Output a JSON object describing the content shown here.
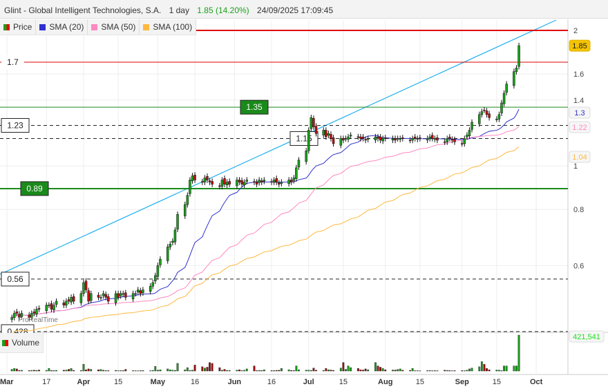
{
  "header": {
    "title": "Glint - Global Intelligent Technologies, S.A.",
    "interval": "1 day",
    "last": "1.85 (14.20%)",
    "datetime": "24/09/2025 17:09:45"
  },
  "legend": {
    "price": "Price",
    "sma20": "SMA (20)",
    "sma50": "SMA (50)",
    "sma100": "SMA (100)",
    "volume": "Volume"
  },
  "watermark": "ProRealTime",
  "colors": {
    "up": "#1aa01a",
    "down": "#c01010",
    "sma20": "#3030d0",
    "sma50": "#ff88c0",
    "sma100": "#ffb840",
    "trend": "#20b0f0",
    "red_level": "#e00000",
    "green_level": "#1a8a1a"
  },
  "chart_data": {
    "type": "candlestick",
    "scale": "log",
    "y_ticks": [
      "2",
      "1.6",
      "1.4",
      "1",
      "0.8",
      "0.6"
    ],
    "x_ticks": [
      "Mar",
      "17",
      "Apr",
      "15",
      "May",
      "16",
      "Jun",
      "16",
      "Jul",
      "15",
      "Aug",
      "15",
      "Sep",
      "15",
      "Oct"
    ],
    "closes": [
      0.46,
      0.47,
      0.47,
      0.46,
      0.47,
      0.46,
      0.47,
      0.47,
      0.48,
      0.48,
      0.49,
      0.49,
      0.48,
      0.49,
      0.5,
      0.49,
      0.5,
      0.5,
      0.51,
      0.5,
      0.52,
      0.55,
      0.53,
      0.5,
      0.52,
      0.51,
      0.51,
      0.52,
      0.51,
      0.5,
      0.52,
      0.51,
      0.52,
      0.52,
      0.51,
      0.52,
      0.52,
      0.53,
      0.52,
      0.53,
      0.54,
      0.55,
      0.57,
      0.6,
      0.62,
      0.66,
      0.67,
      0.68,
      0.72,
      0.78,
      0.82,
      0.86,
      0.93,
      0.95,
      0.93,
      0.92,
      0.94,
      0.93,
      0.92,
      0.91,
      0.9,
      0.93,
      0.91,
      0.92,
      0.91,
      0.93,
      0.92,
      0.91,
      0.92,
      0.93,
      0.92,
      0.91,
      0.93,
      0.92,
      0.93,
      0.92,
      0.93,
      0.92,
      0.91,
      0.92,
      0.93,
      0.92,
      0.94,
      0.99,
      1.03,
      1.08,
      1.2,
      1.28,
      1.22,
      1.18,
      1.2,
      1.16,
      1.18,
      1.15,
      1.12,
      1.15,
      1.14,
      1.15,
      1.16,
      1.17,
      1.16,
      1.15,
      1.15,
      1.14,
      1.15,
      1.16,
      1.15,
      1.14,
      1.15,
      1.15,
      1.15,
      1.14,
      1.15,
      1.15,
      1.15,
      1.14,
      1.15,
      1.15,
      1.15,
      1.15,
      1.15,
      1.16,
      1.15,
      1.15,
      1.14,
      1.13,
      1.15,
      1.15,
      1.14,
      1.13,
      1.12,
      1.15,
      1.17,
      1.2,
      1.25,
      1.3,
      1.32,
      1.33,
      1.3,
      1.28,
      1.27,
      1.3,
      1.38,
      1.45,
      1.52,
      1.62,
      1.65,
      1.85
    ],
    "volumes_thousands": [
      20,
      30,
      25,
      8,
      8,
      6,
      8,
      10,
      8,
      12,
      8,
      30,
      6,
      6,
      8,
      10,
      12,
      20,
      30,
      8,
      6,
      80,
      15,
      25,
      20,
      15,
      18,
      10,
      5,
      5,
      8,
      4,
      5,
      6,
      20,
      5,
      4,
      3,
      5,
      6,
      4,
      8,
      55,
      10,
      15,
      25,
      15,
      10,
      8,
      90,
      15,
      40,
      8,
      10,
      70,
      50,
      35,
      45,
      100,
      90,
      40,
      10,
      20,
      8,
      6,
      10,
      15,
      5,
      10,
      25,
      60,
      5,
      8,
      6,
      15,
      5,
      6,
      8,
      10,
      30,
      15,
      8,
      7,
      60,
      15,
      10,
      10,
      8,
      35,
      10,
      8,
      30,
      15,
      12,
      8,
      35,
      100,
      20,
      60,
      40,
      30,
      15,
      12,
      25,
      15,
      100,
      60,
      45,
      30,
      15,
      12,
      12,
      18,
      25,
      10,
      8,
      30,
      4,
      4,
      3,
      5,
      6,
      4,
      5,
      4,
      10,
      8,
      6,
      3,
      5,
      5,
      4,
      10,
      25,
      35,
      50,
      110,
      80,
      30,
      15,
      12,
      10,
      5,
      60,
      60,
      60,
      60,
      421.541
    ],
    "levels": [
      {
        "value": 2.0,
        "style": "red-thick"
      },
      {
        "value": 1.7,
        "label": "1.7",
        "style": "red"
      },
      {
        "value": 1.35,
        "label": "1.35",
        "style": "green"
      },
      {
        "value": 1.23,
        "label": "1.23",
        "style": "dashed"
      },
      {
        "value": 1.15,
        "label": "1.15",
        "style": "dashed"
      },
      {
        "value": 0.89,
        "label": "0.89",
        "style": "green-thick"
      },
      {
        "value": 0.56,
        "label": "0.56",
        "style": "dashed"
      },
      {
        "value": 0.428,
        "label": "0.428",
        "style": "dashed"
      }
    ],
    "right_labels": {
      "last": "1.85",
      "sma20": "1.3",
      "sma50": "1.22",
      "sma100": "1.04",
      "volume": "421,541"
    }
  }
}
